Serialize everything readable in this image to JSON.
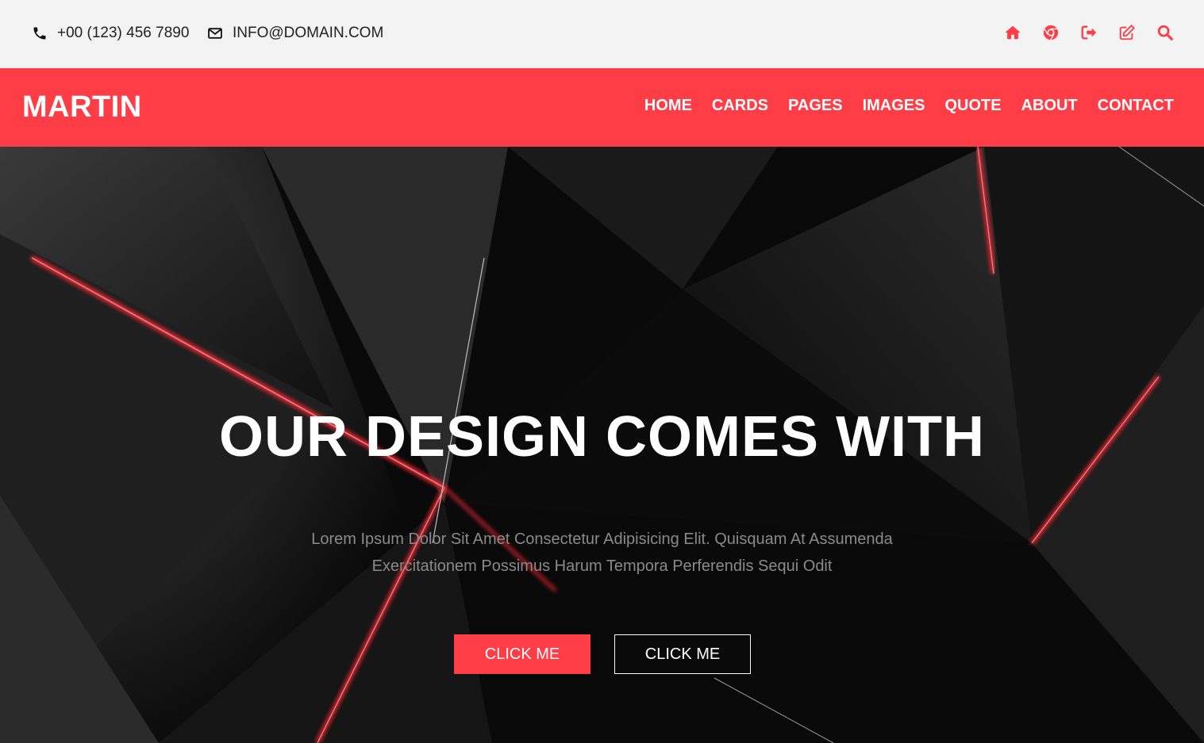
{
  "topbar": {
    "phone": "+00 (123) 456 7890",
    "email": "INFO@DOMAIN.COM",
    "icons": [
      "home-icon",
      "chrome-icon",
      "sign-out-icon",
      "edit-icon",
      "search-icon"
    ]
  },
  "navbar": {
    "brand": "MARTIN",
    "items": [
      "HOME",
      "CARDS",
      "PAGES",
      "IMAGES",
      "QUOTE",
      "ABOUT",
      "CONTACT"
    ]
  },
  "hero": {
    "headline": "OUR DESIGN COMES WITH",
    "subtext_line1": "Lorem Ipsum Dolor Sit Amet Consectetur Adipisicing Elit. Quisquam At Assumenda",
    "subtext_line2": "Exercitationem Possimus Harum Tempora Perferendis Sequi Odit",
    "primary_button": "CLICK ME",
    "secondary_button": "CLICK ME"
  },
  "colors": {
    "accent": "#ff3d46",
    "topbar_bg": "#f3f3f3",
    "hero_bg": "#090909"
  }
}
